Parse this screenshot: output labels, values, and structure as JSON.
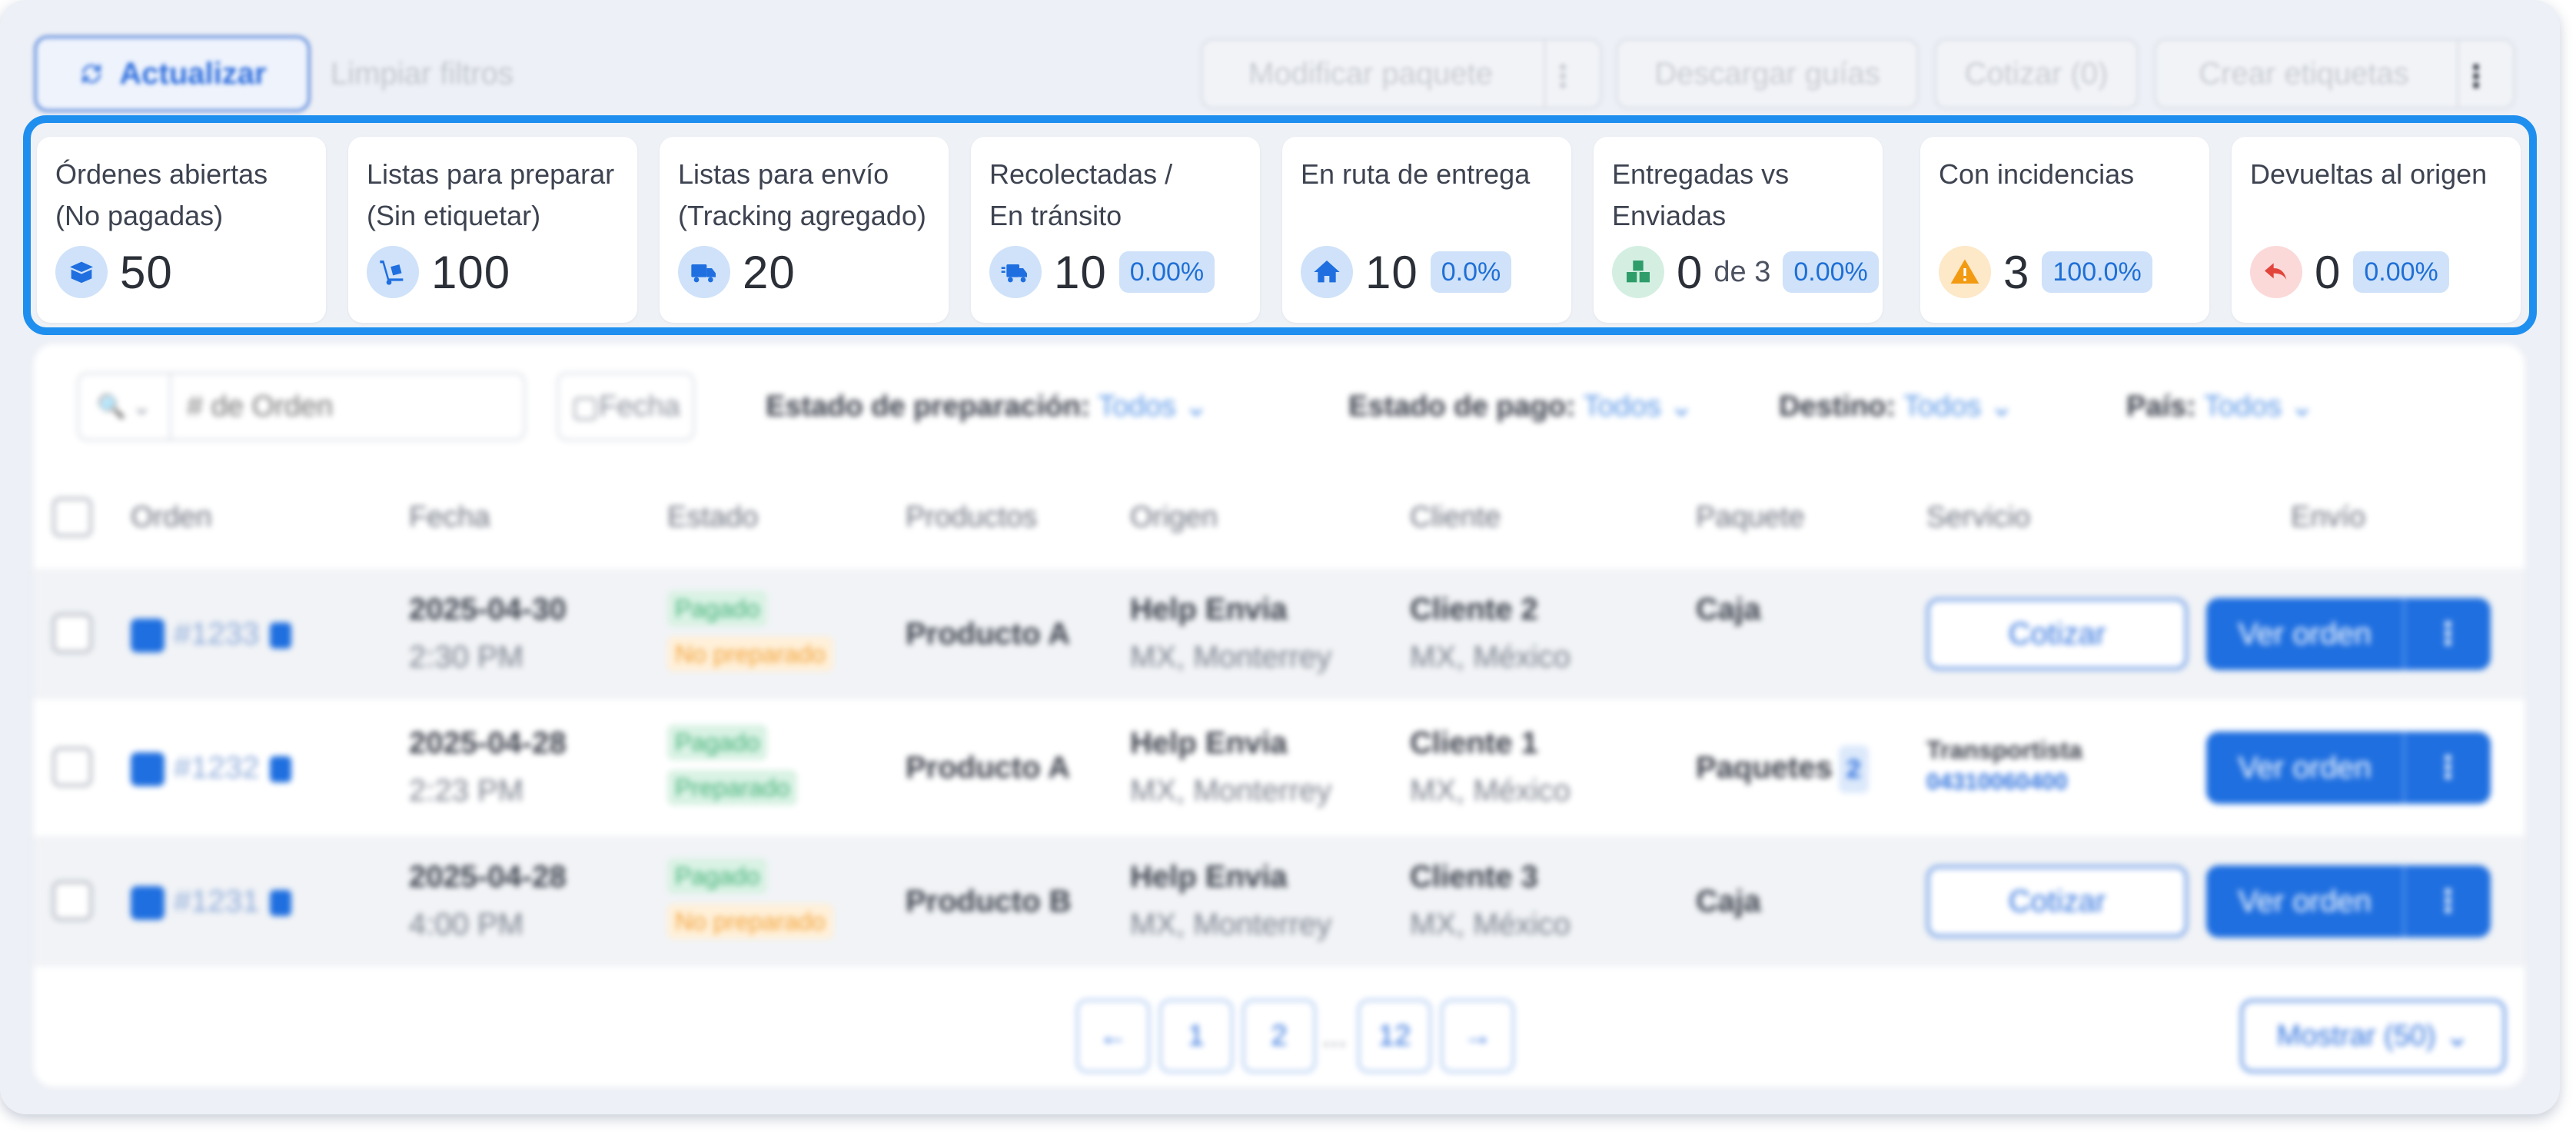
{
  "toolbar": {
    "update_label": "Actualizar",
    "clear_filters_label": "Limpiar filtros",
    "modify_package_label": "Modificar paquete",
    "download_guides_label": "Descargar guías",
    "quote_label": "Cotizar (0)",
    "create_labels_label": "Crear etiquetas",
    "more_symbol": "⋮"
  },
  "stats": [
    {
      "label": "Órdenes abiertas\n(No pagadas)",
      "value": "50",
      "icon": "open-box-icon",
      "of": "",
      "percent": ""
    },
    {
      "label": "Listas para preparar\n(Sin etiquetar)",
      "value": "100",
      "icon": "hand-truck-icon",
      "of": "",
      "percent": ""
    },
    {
      "label": "Listas para envío\n(Tracking agregado)",
      "value": "20",
      "icon": "truck-icon",
      "of": "",
      "percent": ""
    },
    {
      "label": "Recolectadas /\nEn tránsito",
      "value": "10",
      "icon": "fast-truck-icon",
      "of": "",
      "percent": "0.00%"
    },
    {
      "label": "En ruta de entrega",
      "value": "10",
      "icon": "home-icon",
      "of": "",
      "percent": "0.0%"
    },
    {
      "label": "Entregadas vs\nEnviadas",
      "value": "0",
      "icon": "boxes-icon",
      "of": "de 3",
      "percent": "0.00%"
    },
    {
      "label": "Con incidencias",
      "value": "3",
      "icon": "warning-icon",
      "of": "",
      "percent": "100.0%"
    },
    {
      "label": "Devueltas al origen",
      "value": "0",
      "icon": "return-arrow-icon",
      "of": "",
      "percent": "0.00%"
    }
  ],
  "filters": {
    "search_placeholder": "# de Orden",
    "date_label": "Fecha",
    "prep_state_label": "Estado de preparación:",
    "prep_state_value": "Todos",
    "pay_state_label": "Estado de pago:",
    "pay_state_value": "Todos",
    "destination_label": "Destino:",
    "destination_value": "Todos",
    "country_label": "País:",
    "country_value": "Todos"
  },
  "columns": [
    "Orden",
    "Fecha",
    "Estado",
    "Productos",
    "Origen",
    "Cliente",
    "Paquete",
    "Servicio",
    "Envío"
  ],
  "rows": [
    {
      "order": "#1233",
      "date": "2025-04-30",
      "time": "2:30 PM",
      "status1": "Pagado",
      "status2": "No preparado",
      "product": "Producto A",
      "origin": "Help Envia",
      "origin_sub": "MX, Monterrey",
      "client": "Cliente 2",
      "client_sub": "MX, México",
      "package": "Caja",
      "service": "Cotizar",
      "view": "Ver orden"
    },
    {
      "order": "#1232",
      "date": "2025-04-28",
      "time": "2:23 PM",
      "status1": "Pagado",
      "status2": "Preparado",
      "product": "Producto A",
      "origin": "Help Envia",
      "origin_sub": "MX, Monterrey",
      "client": "Cliente 1",
      "client_sub": "MX, México",
      "package": "Paquetes",
      "package_qty": "2",
      "carrier": "Transportista",
      "tracking": "04310060400",
      "view": "Ver orden"
    },
    {
      "order": "#1231",
      "date": "2025-04-28",
      "time": "4:00 PM",
      "status1": "Pagado",
      "status2": "No preparado",
      "product": "Producto B",
      "origin": "Help Envia",
      "origin_sub": "MX, Monterrey",
      "client": "Cliente 3",
      "client_sub": "MX, México",
      "package": "Caja",
      "service": "Cotizar",
      "view": "Ver orden"
    }
  ],
  "pagination": {
    "prev": "←",
    "next": "→",
    "pages": [
      "1",
      "2",
      "12"
    ],
    "ellipsis": "...",
    "show_label": "Mostrar (50)"
  },
  "colors": {
    "accent": "#1f8fef",
    "primary": "#1f6fe0",
    "badge_bg": "#cfe2f9"
  }
}
